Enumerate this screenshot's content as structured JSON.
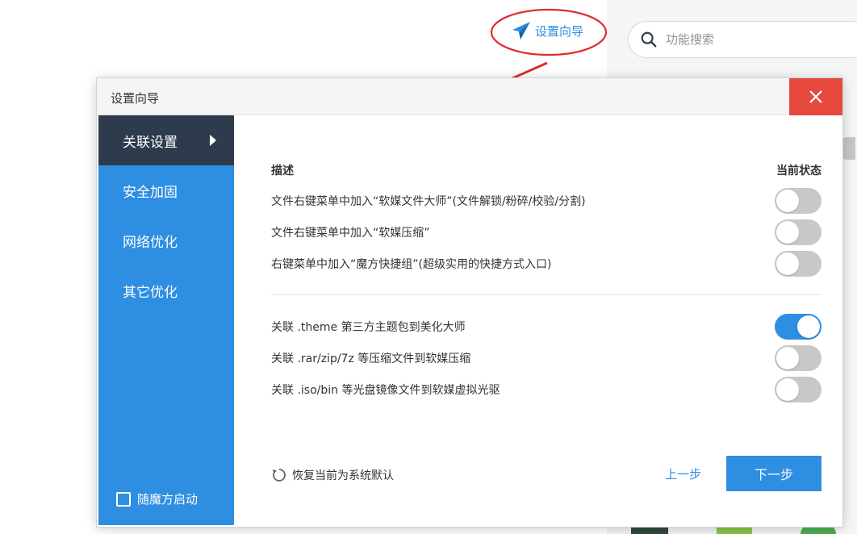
{
  "header": {
    "wizard_link_label": "设置向导",
    "search_placeholder": "功能搜索"
  },
  "dialog": {
    "title": "设置向导",
    "sidebar": {
      "items": [
        {
          "label": "关联设置",
          "active": true
        },
        {
          "label": "安全加固",
          "active": false
        },
        {
          "label": "网络优化",
          "active": false
        },
        {
          "label": "其它优化",
          "active": false
        }
      ],
      "autostart_label": "随魔方启动"
    },
    "columns": {
      "description": "描述",
      "state": "当前状态"
    },
    "context_menu_rows": [
      {
        "label": "文件右键菜单中加入“软媒文件大师”(文件解锁/粉碎/校验/分割)",
        "enabled": false
      },
      {
        "label": "文件右键菜单中加入“软媒压缩”",
        "enabled": false
      },
      {
        "label": "右键菜单中加入“魔方快捷组”(超级实用的快捷方式入口)",
        "enabled": false
      }
    ],
    "association_rows": [
      {
        "label": "关联 .theme 第三方主题包到美化大师",
        "enabled": true
      },
      {
        "label": "关联 .rar/zip/7z 等压缩文件到软媒压缩",
        "enabled": false
      },
      {
        "label": "关联 .iso/bin 等光盘镜像文件到软媒虚拟光驱",
        "enabled": false
      }
    ],
    "footer": {
      "restore_label": "恢复当前为系统默认",
      "prev_label": "上一步",
      "next_label": "下一步"
    }
  },
  "colors": {
    "accent": "#2e8ee1",
    "sidebar_active": "#2e3b4c",
    "close": "#e5483d",
    "annotation": "#e02c2c"
  }
}
